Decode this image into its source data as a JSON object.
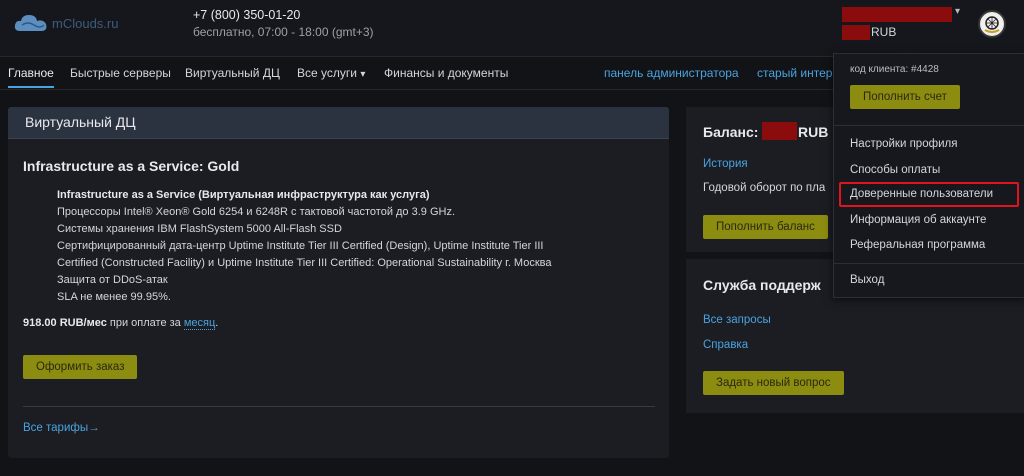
{
  "header": {
    "logo_text": "mClouds.ru",
    "phone": "+7 (800) 350-01-20",
    "phone_note": "бесплатно, 07:00 - 18:00 (gmt+3)",
    "balance_currency": "RUB"
  },
  "nav": {
    "items": [
      {
        "label": "Главное"
      },
      {
        "label": "Быстрые серверы"
      },
      {
        "label": "Виртуальный ДЦ"
      },
      {
        "label": "Все услуги"
      },
      {
        "label": "Финансы и документы"
      }
    ],
    "admin_link": "панель администратора",
    "old_interface_link": "старый интер"
  },
  "main": {
    "card_title": "Виртуальный ДЦ",
    "product_title": "Infrastructure as a Service: Gold",
    "desc_heading": "Infrastructure as a Service (Виртуальная инфраструктура как услуга)",
    "desc_lines": [
      "Процессоры Intel® Xeon® Gold 6254 и 6248R с тактовой частотой до 3.9 GHz.",
      "Системы хранения IBM FlashSystem 5000 All-Flash SSD",
      "Сертифицированный дата-центр Uptime Institute Tier III Certified (Design), Uptime Institute Tier III",
      "Certified (Constructed Facility) и Uptime Institute Tier III Certified: Operational Sustainability г. Москва",
      "Защита от DDoS-атак",
      "SLA не менее 99.95%."
    ],
    "price": "918.00 RUB/мес",
    "price_suffix": " при оплате за ",
    "price_period": "месяц",
    "price_dot": ".",
    "order_button": "Оформить заказ",
    "all_tariffs": "Все тарифы→"
  },
  "balance_panel": {
    "title": "Баланс:",
    "currency": "RUB",
    "history_link": "История",
    "turnover_text": "Годовой оборот по пла",
    "topup_button": "Пополнить баланс"
  },
  "support_panel": {
    "title": "Служба поддерж",
    "all_requests": "Все запросы",
    "help": "Справка",
    "new_request_button": "Задать новый вопрос"
  },
  "dropdown": {
    "client_code": "код клиента: #4428",
    "topup_button": "Пополнить счет",
    "items": [
      {
        "label": "Настройки профиля"
      },
      {
        "label": "Способы оплаты"
      },
      {
        "label": "Доверенные пользователи"
      },
      {
        "label": "Информация об аккаунте"
      },
      {
        "label": "Реферальная программа"
      }
    ],
    "logout": "Выход"
  },
  "colors": {
    "accent_link": "#4aa3df",
    "button_olive": "#8c8c10",
    "redaction": "#8a0c0c",
    "highlight": "#e0141e"
  }
}
